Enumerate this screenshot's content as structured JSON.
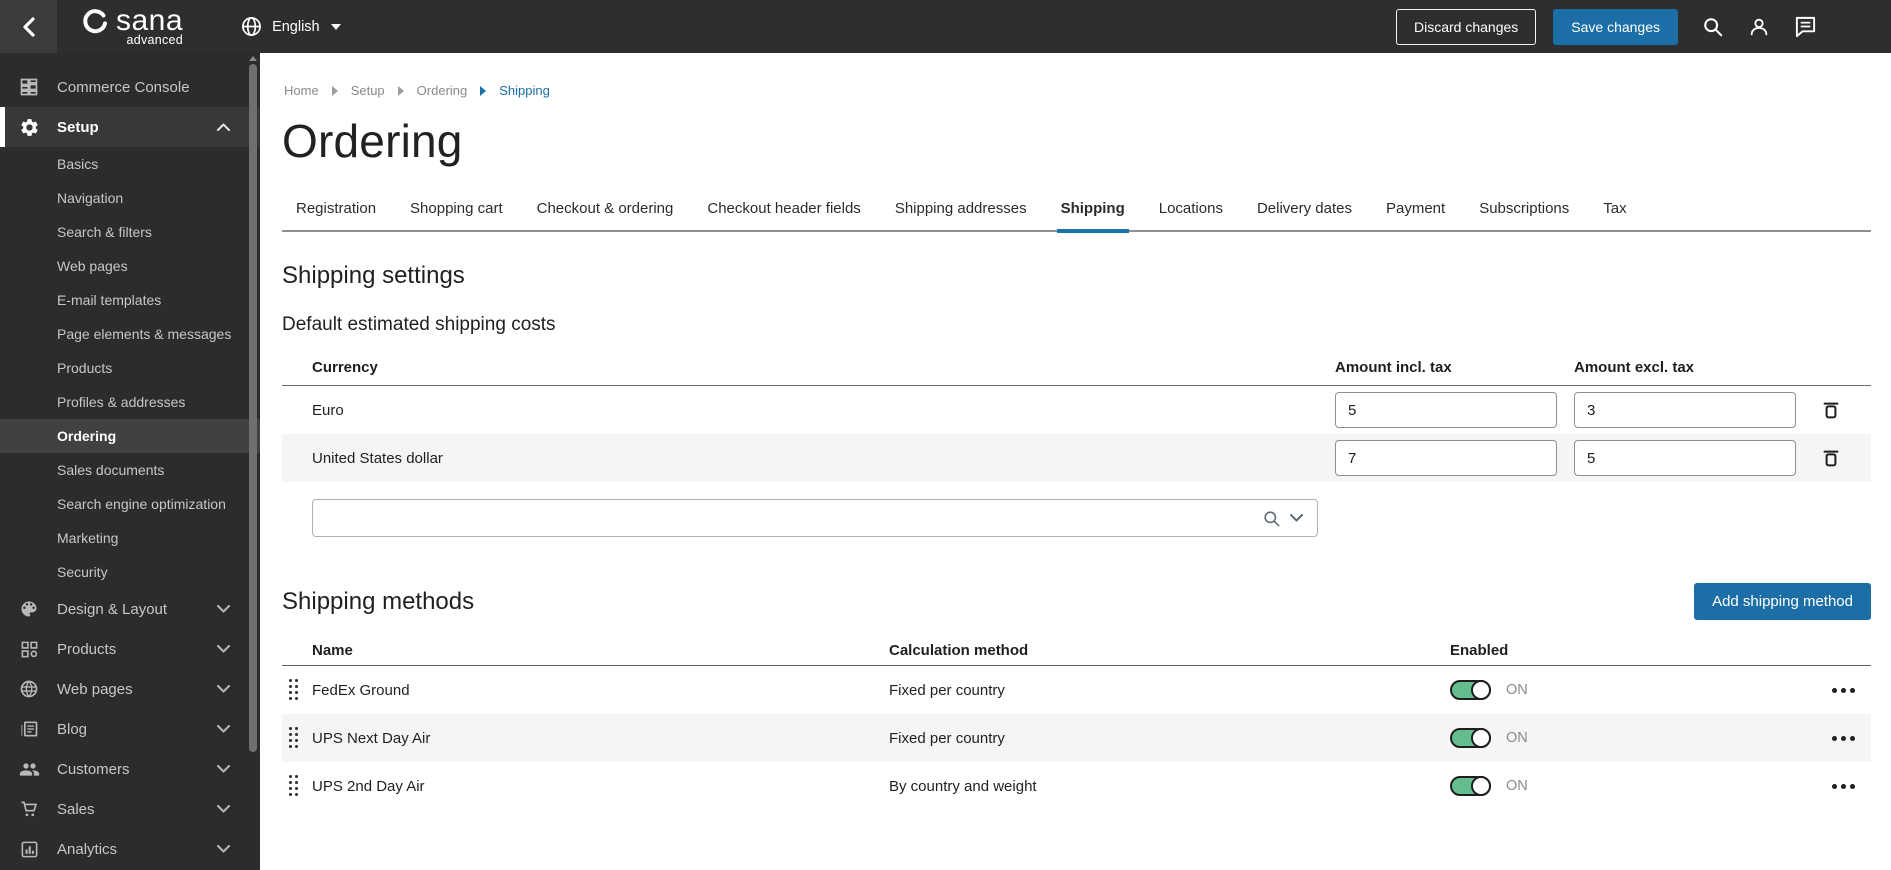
{
  "topbar": {
    "logo_text": "sana",
    "logo_sub": "advanced",
    "language_label": "English",
    "discard_button": "Discard changes",
    "save_button": "Save changes"
  },
  "sidebar": {
    "commerce_console": "Commerce Console",
    "setup": "Setup",
    "setup_children": [
      "Basics",
      "Navigation",
      "Search & filters",
      "Web pages",
      "E-mail templates",
      "Page elements & messages",
      "Products",
      "Profiles & addresses",
      "Ordering",
      "Sales documents",
      "Search engine optimization",
      "Marketing",
      "Security"
    ],
    "selected_child": "Ordering",
    "bottom": [
      "Design & Layout",
      "Products",
      "Web pages",
      "Blog",
      "Customers",
      "Sales",
      "Analytics"
    ]
  },
  "breadcrumb": [
    "Home",
    "Setup",
    "Ordering",
    "Shipping"
  ],
  "page_title": "Ordering",
  "tabs": [
    "Registration",
    "Shopping cart",
    "Checkout & ordering",
    "Checkout header fields",
    "Shipping addresses",
    "Shipping",
    "Locations",
    "Delivery dates",
    "Payment",
    "Subscriptions",
    "Tax"
  ],
  "active_tab": "Shipping",
  "shipping_settings": {
    "heading": "Shipping settings",
    "subheading": "Default estimated shipping costs",
    "columns": [
      "Currency",
      "Amount incl. tax",
      "Amount excl. tax"
    ],
    "rows": [
      {
        "currency": "Euro",
        "amount_incl": "5",
        "amount_excl": "3"
      },
      {
        "currency": "United States dollar",
        "amount_incl": "7",
        "amount_excl": "5"
      }
    ]
  },
  "shipping_methods": {
    "heading": "Shipping methods",
    "add_button": "Add shipping method",
    "columns": [
      "Name",
      "Calculation method",
      "Enabled"
    ],
    "rows": [
      {
        "name": "FedEx Ground",
        "calculation_method": "Fixed per country",
        "enabled": true,
        "enabled_label": "ON"
      },
      {
        "name": "UPS Next Day Air",
        "calculation_method": "Fixed per country",
        "enabled": true,
        "enabled_label": "ON"
      },
      {
        "name": "UPS 2nd Day Air",
        "calculation_method": "By country and weight",
        "enabled": true,
        "enabled_label": "ON"
      }
    ]
  },
  "colors": {
    "accent_blue": "#1b6fa6",
    "tab_underline": "#1a73ad",
    "toggle_green": "#63bd8f",
    "topbar_bg": "#2e2e30",
    "sidebar_bg": "#2c2c2e",
    "row_alt_bg": "#f5f5f6"
  }
}
